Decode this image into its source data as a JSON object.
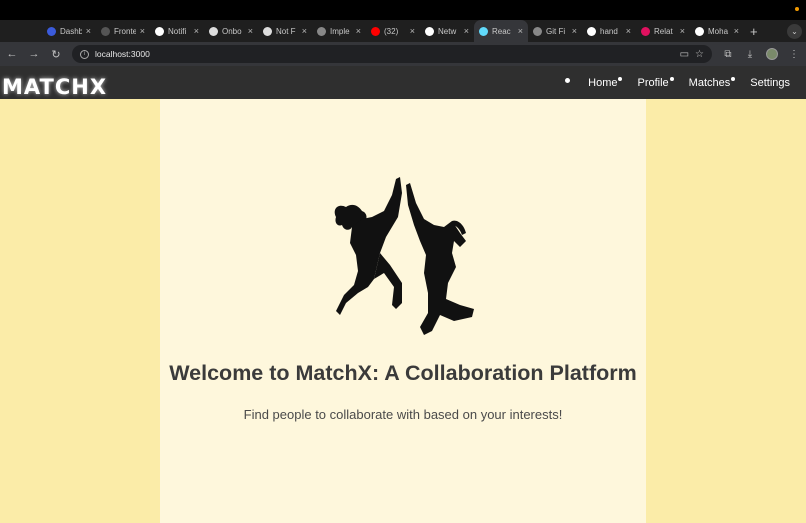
{
  "browser": {
    "tabs": [
      {
        "title": "Dashb",
        "icon": "e-logo-icon",
        "color": "#3b5bdb",
        "active": false
      },
      {
        "title": "Fronte",
        "icon": "e-logo-icon",
        "color": "#555555",
        "active": false
      },
      {
        "title": "Notifi",
        "icon": "github-icon",
        "color": "#ffffff",
        "active": false
      },
      {
        "title": "Onbo",
        "icon": "shield-icon",
        "color": "#dddddd",
        "active": false
      },
      {
        "title": "Not F",
        "icon": "shield-icon",
        "color": "#dddddd",
        "active": false
      },
      {
        "title": "Imple",
        "icon": "globe-icon",
        "color": "#888888",
        "active": false
      },
      {
        "title": "(32)",
        "icon": "youtube-icon",
        "color": "#ff0000",
        "active": false
      },
      {
        "title": "Netw",
        "icon": "github-icon",
        "color": "#ffffff",
        "active": false
      },
      {
        "title": "Reac",
        "icon": "react-icon",
        "color": "#61dafb",
        "active": true
      },
      {
        "title": "Git Fi",
        "icon": "globe-icon",
        "color": "#888888",
        "active": false
      },
      {
        "title": "hand",
        "icon": "google-icon",
        "color": "#ffffff",
        "active": false
      },
      {
        "title": "Relat",
        "icon": "ruby-icon",
        "color": "#e0115f",
        "active": false
      },
      {
        "title": "Moha",
        "icon": "github-icon",
        "color": "#ffffff",
        "active": false
      }
    ],
    "url": "localhost:3000"
  },
  "navbar": {
    "brand": "MATCHX",
    "links": [
      {
        "label": "Home",
        "dot": true
      },
      {
        "label": "Profile",
        "dot": true
      },
      {
        "label": "Matches",
        "dot": true
      },
      {
        "label": "Settings",
        "dot": false
      }
    ]
  },
  "hero": {
    "title": "Welcome to MatchX: A Collaboration Platform",
    "subtitle": "Find people to collaborate with based on your interests!"
  },
  "colors": {
    "page_bg": "#fbeca8",
    "panel_bg": "#fef7dc",
    "navbar_bg": "#2f2f2f"
  }
}
